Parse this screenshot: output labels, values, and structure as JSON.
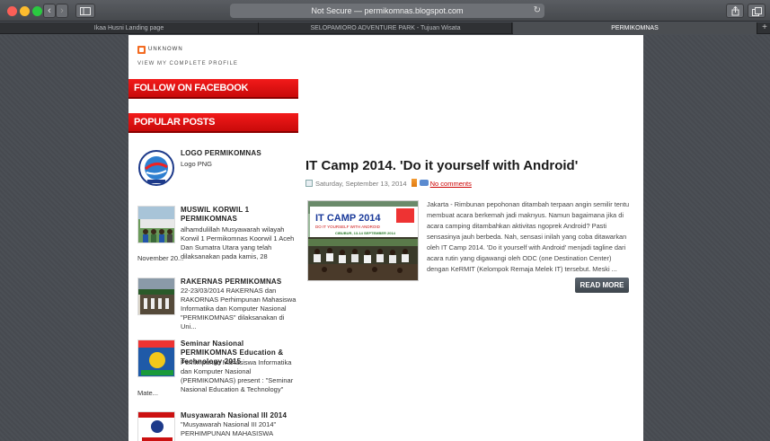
{
  "browser": {
    "address": "Not Secure — permikomnas.blogspot.com",
    "tabs": [
      "Ikaa Husni Landing page",
      "SELOPAMIORO ADVENTURE PARK - Tujuan Wisata",
      "PERMIKOMNAS"
    ],
    "active_tab": 2
  },
  "profile": {
    "name": "UNKNOWN",
    "link": "VIEW MY COMPLETE PROFILE"
  },
  "widgets": {
    "facebook_title": "FOLLOW ON FACEBOOK",
    "popular_title": "POPULAR POSTS"
  },
  "popular_posts": [
    {
      "title": "LOGO PERMIKOMNAS",
      "snippet": "Logo PNG"
    },
    {
      "title": "MUSWIL KORWIL 1 PERMIKOMNAS",
      "snippet_right": "alhamdulillah Musyawarah wilayah Korwil 1 Permikomnas Koorwil 1 Aceh Dan Sumatra Utara yang telah dilaksanakan pada kamis, 28",
      "snippet_more": "November 20..."
    },
    {
      "title": "RAKERNAS PERMIKOMNAS",
      "snippet_right": "22-23/03/2014 RAKERNAS dan RAKORNAS Perhimpunan Mahasiswa Informatika dan Komputer Nasional \"PERMIKOMNAS\" dilaksanakan di Uni..."
    },
    {
      "title": "Seminar Nasional PERMIKOMNAS Education & Technology 2015",
      "snippet_right": "Perhimpunan Mahasiswa Informatika dan Komputer Nasional (PERMIKOMNAS) present : \"Seminar Nasional Education & Technology\"",
      "snippet_more": "Mate..."
    },
    {
      "title": "Musyawarah Nasional III 2014",
      "snippet_right": "\"Musyawarah Nasional III 2014\" PERHIMPUNAN MAHASISWA"
    }
  ],
  "article": {
    "title": "IT Camp 2014. 'Do it yourself with Android'",
    "date": "Saturday, September 13, 2014",
    "comments": "No comments",
    "body": "Jakarta - Rimbunan pepohonan ditambah terpaan angin semilir tentu membuat acara berkemah jadi maknyus. Namun bagaimana jika di acara camping ditambahkan aktivitas ngoprek Android? Pasti sensasinya jauh berbeda. Nah, sensasi inilah yang coba ditawarkan oleh IT Camp 2014. 'Do it yourself with Android' menjadi tagline dari acara rutin yang digawangi oleh ODC (one Destination Center) dengan KeRMIT (Kelompok Remaja Melek IT) tersebut. Meski ...",
    "read_more": "READ MORE",
    "banner_text": "IT CAMP 2014",
    "banner_sub": "DO IT YOURSELF WITH ANDROID",
    "banner_place": "CIBUBUR, 13-14 SEPTEMBER 2014"
  },
  "colors": {
    "widget_red": "#e01010",
    "link_red": "#cc0000",
    "page_bg": "#4b4f55"
  }
}
